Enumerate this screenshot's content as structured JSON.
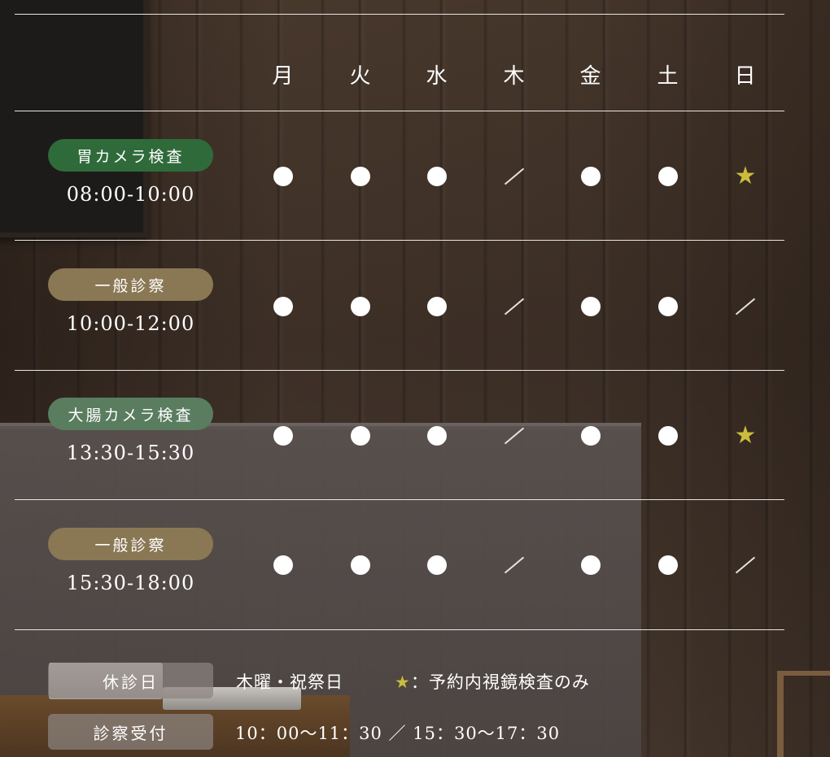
{
  "days": [
    "月",
    "火",
    "水",
    "木",
    "金",
    "土",
    "日"
  ],
  "rows": [
    {
      "label": "胃カメラ検査",
      "color": "#2f6b3a",
      "time": "08:00-10:00",
      "cells": [
        "dot",
        "dot",
        "dot",
        "slash",
        "dot",
        "dot",
        "star"
      ]
    },
    {
      "label": "一般診察",
      "color": "#8a7855",
      "time": "10:00-12:00",
      "cells": [
        "dot",
        "dot",
        "dot",
        "slash",
        "dot",
        "dot",
        "slash"
      ]
    },
    {
      "label": "大腸カメラ検査",
      "color": "#5a7d60",
      "time": "13:30-15:30",
      "cells": [
        "dot",
        "dot",
        "dot",
        "slash",
        "dot",
        "dot",
        "star"
      ]
    },
    {
      "label": "一般診察",
      "color": "#8a7855",
      "time": "15:30-18:00",
      "cells": [
        "dot",
        "dot",
        "dot",
        "slash",
        "dot",
        "dot",
        "slash"
      ]
    }
  ],
  "symbols": {
    "star": "★"
  },
  "info": {
    "closed_label": "休診日",
    "closed_value": "木曜・祝祭日",
    "legend_star": "★",
    "legend_text": "：予約内視鏡検査のみ",
    "reception_label": "診察受付",
    "reception_value": "10：00〜11：30 ／ 15：30〜17：30"
  },
  "colors": {
    "star": "#cbbd3c",
    "line": "#e9e6e2"
  }
}
